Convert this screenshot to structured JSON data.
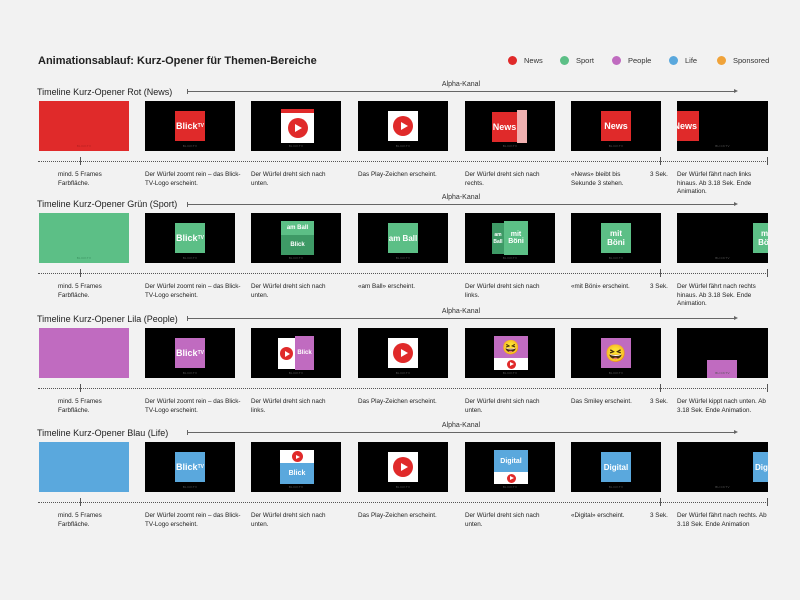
{
  "title": "Animationsablauf: Kurz-Opener für Themen-Bereiche",
  "legend": [
    {
      "label": "News",
      "color": "#e02a2a"
    },
    {
      "label": "Sport",
      "color": "#5cbf86"
    },
    {
      "label": "People",
      "color": "#c06bc0"
    },
    {
      "label": "Life",
      "color": "#5aa8dd"
    },
    {
      "label": "Sponsored",
      "color": "#f0a33a"
    }
  ],
  "alpha_label": "Alpha-Kanal",
  "watermark": "BLICKTV",
  "sek_label": "3 Sek.",
  "sections": [
    {
      "title": "Timeline Kurz-Opener Rot (News)",
      "color": "#e02a2a",
      "topic_word": "News",
      "captions": [
        "mind. 5 Frames Farbfläche.",
        "Der Würfel zoomt rein – das Blick-TV-Logo erscheint.",
        "Der Würfel dreht sich nach unten.",
        "Das Play-Zeichen erscheint.",
        "Der Würfel dreht sich nach rechts.",
        "«News» bleibt bis Sekunde 3 stehen.",
        "Der Würfel fährt nach links hinaus. Ab 3.18 Sek. Ende Animation."
      ]
    },
    {
      "title": "Timeline Kurz-Opener Grün (Sport)",
      "color": "#5cbf86",
      "topic_word": "am Ball",
      "topic_word2": "mit Böni",
      "captions": [
        "mind. 5 Frames Farbfläche.",
        "Der Würfel zoomt rein – das Blick-TV-Logo erscheint.",
        "Der Würfel dreht sich nach unten.",
        "«am Ball» erscheint.",
        "Der Würfel dreht sich nach links.",
        "«mit Böni» erscheint.",
        "Der Würfel fährt nach rechts hinaus. Ab 3.18 Sek. Ende Animation."
      ]
    },
    {
      "title": "Timeline Kurz-Opener Lila (People)",
      "color": "#c06bc0",
      "captions": [
        "mind. 5 Frames Farbfläche.",
        "Der Würfel zoomt rein – das Blick-TV-Logo erscheint.",
        "Der Würfel dreht sich nach links.",
        "Das Play-Zeichen erscheint.",
        "Der Würfel dreht sich nach unten.",
        "Das Smiley erscheint.",
        "Der Würfel kippt nach unten. Ab 3.18 Sek. Ende Animation."
      ]
    },
    {
      "title": "Timeline Kurz-Opener Blau (Life)",
      "color": "#5aa8dd",
      "topic_word": "Digital",
      "captions": [
        "mind. 5 Frames Farbfläche.",
        "Der Würfel zoomt rein – das Blick-TV-Logo erscheint.",
        "Der Würfel dreht sich nach unten.",
        "Das Play-Zeichen erscheint.",
        "Der Würfel dreht sich nach unten.",
        "«Digital» erscheint.",
        "Der Würfel fährt nach rechts. Ab 3.18 Sek. Ende Animation"
      ]
    }
  ]
}
